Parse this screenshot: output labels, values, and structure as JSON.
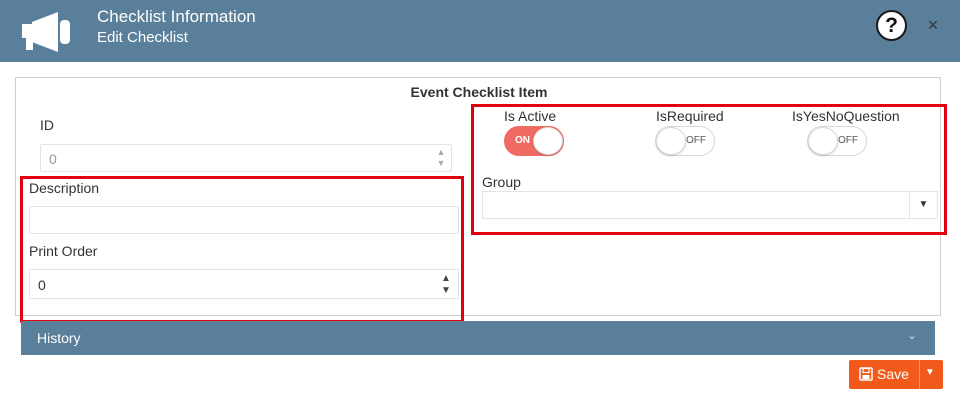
{
  "header": {
    "title": "Checklist Information",
    "subtitle": "Edit Checklist",
    "help_icon": "question-circle-icon",
    "help_glyph": "?",
    "close_glyph": "×",
    "bg_color": "#5a7f9a"
  },
  "panel": {
    "title": "Event Checklist Item"
  },
  "form": {
    "id_label": "ID",
    "id_value": "0",
    "description_label": "Description",
    "description_value": "",
    "print_order_label": "Print Order",
    "print_order_value": "0",
    "spin_up": "▲",
    "spin_down": "▼"
  },
  "toggles": {
    "is_active": {
      "label": "Is Active",
      "state": "ON"
    },
    "is_required": {
      "label": "IsRequired",
      "state": "OFF"
    },
    "is_yes_no_question": {
      "label": "IsYesNoQuestion",
      "state": "OFF"
    },
    "on_color": "#f06a64"
  },
  "group": {
    "label": "Group",
    "value": "",
    "arrow": "▼"
  },
  "history": {
    "label": "History",
    "chevron": "⌄"
  },
  "save": {
    "label": "Save",
    "icon": "floppy-disk-icon",
    "arrow": "▼",
    "color": "#f15a1a"
  },
  "highlight_color": "#e2000f"
}
